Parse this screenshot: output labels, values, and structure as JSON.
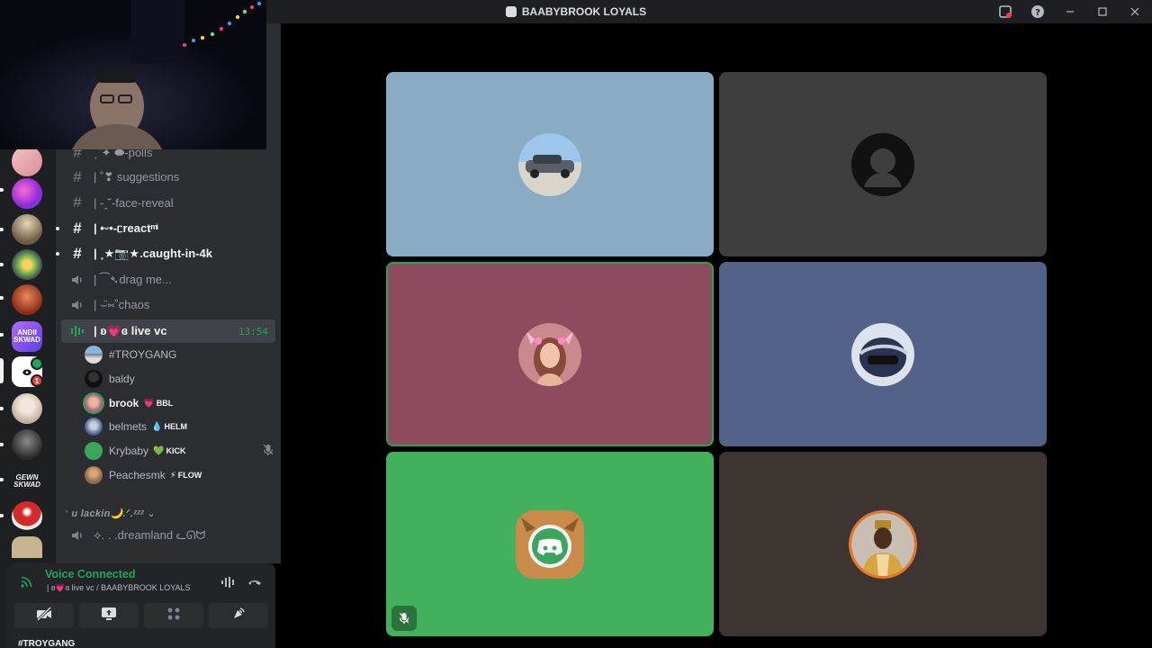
{
  "window": {
    "title": "BAABYBROOK LOYALS",
    "controls": [
      "inbox-icon",
      "help-icon",
      "minimize-icon",
      "maximize-icon",
      "close-icon"
    ]
  },
  "servers": [
    {
      "name": "server-1",
      "color": "#e8a0a6"
    },
    {
      "name": "server-2",
      "color": "#9b59ff"
    },
    {
      "name": "server-3",
      "color": "#7e6a55"
    },
    {
      "name": "server-4",
      "color": "#6aa84f"
    },
    {
      "name": "server-5",
      "color": "#c0553a"
    },
    {
      "name": "server-andii-skwad",
      "label": "ANDII SKWAD",
      "color": "#8a5cf6"
    },
    {
      "name": "server-brook",
      "color": "#ffffff",
      "badge": "1"
    },
    {
      "name": "server-8",
      "color": "#e9e4dc"
    },
    {
      "name": "server-9",
      "color": "#3a3a3a"
    },
    {
      "name": "server-gewn-skwad",
      "label": "GEWN SKWAD",
      "color": "#1e1f22"
    },
    {
      "name": "server-mushroom",
      "color": "#d12b2b"
    },
    {
      "name": "server-12",
      "color": "#c7b58f"
    }
  ],
  "channels": [
    {
      "kind": "text",
      "label": "ˏˋ✦ ⬬-polls",
      "unread": false
    },
    {
      "kind": "text",
      "label": "| ˚❣ suggestions",
      "unread": false
    },
    {
      "kind": "text",
      "label": "| -ꞈ˘-face-reveal",
      "unread": false
    },
    {
      "kind": "text",
      "label": "| •ᵕ•-ᥴreact ͫ ͥ",
      "unread": true
    },
    {
      "kind": "text",
      "label": "| ˳★📷★.caught-in-4k",
      "unread": true
    },
    {
      "kind": "voice",
      "label": "| ⁀➴drag me...",
      "unread": false
    },
    {
      "kind": "voice",
      "label": "| ⌣̈⑅˚chaos",
      "unread": false
    }
  ],
  "active_voice_channel": {
    "label": "| ʚ💗ɞ live vc",
    "timer": "13:54"
  },
  "voice_users": [
    {
      "name": "#TROYGANG",
      "bold": false,
      "tag": "",
      "tag_icon": "",
      "avatar_color": "#6b8fb8"
    },
    {
      "name": "baldy",
      "bold": false,
      "tag": "",
      "tag_icon": "",
      "avatar_color": "#111111"
    },
    {
      "name": "brook",
      "bold": true,
      "tag": "BBL",
      "tag_icon": "💗",
      "avatar_color": "#b56576"
    },
    {
      "name": "belmets",
      "bold": false,
      "tag": "HELM",
      "tag_icon": "💧",
      "avatar_color": "#4a5a8a"
    },
    {
      "name": "Krybaby",
      "bold": false,
      "tag": "KICK",
      "tag_icon": "💚",
      "avatar_color": "#3ba55c",
      "muted": true
    },
    {
      "name": "Peachesmk",
      "bold": false,
      "tag": "FLOW",
      "tag_icon": "⚡",
      "avatar_color": "#8a6a4a"
    }
  ],
  "category": {
    "label": "ˑ u lackin🌙.ᐟ.ᶻᶻᶻ ⌄"
  },
  "after_category_channel": {
    "kind": "voice",
    "label": "⟡. . .dreamland ᓚᘏᗢ"
  },
  "voice_panel": {
    "state": "Voice Connected",
    "location": "| ʚ💗ɞ live vc / BAABYBROOK LOYALS",
    "actions": [
      "camera-off-icon",
      "screen-share-icon",
      "activities-icon",
      "soundboard-icon"
    ],
    "peek_user": "#TROYGANG"
  },
  "tiles": [
    {
      "name": "tile-troygang",
      "bg": "#8aabc4",
      "avatar": "car",
      "speaking": false
    },
    {
      "name": "tile-baldy",
      "bg": "#3e3e3e",
      "avatar": "default",
      "speaking": false
    },
    {
      "name": "tile-brook",
      "bg": "#8f4b5e",
      "avatar": "girl",
      "speaking": true
    },
    {
      "name": "tile-belmets",
      "bg": "#536288",
      "avatar": "helmet",
      "speaking": false
    },
    {
      "name": "tile-krybaby",
      "bg": "#43b05c",
      "avatar": "discord-cat",
      "speaking": false,
      "muted": true
    },
    {
      "name": "tile-peachesmk",
      "bg": "#3d3532",
      "avatar": "man",
      "speaking": false
    }
  ],
  "colors": {
    "accent_green": "#23a55a",
    "rail_bg": "#1e1f22",
    "channels_bg": "#2b2d31"
  }
}
